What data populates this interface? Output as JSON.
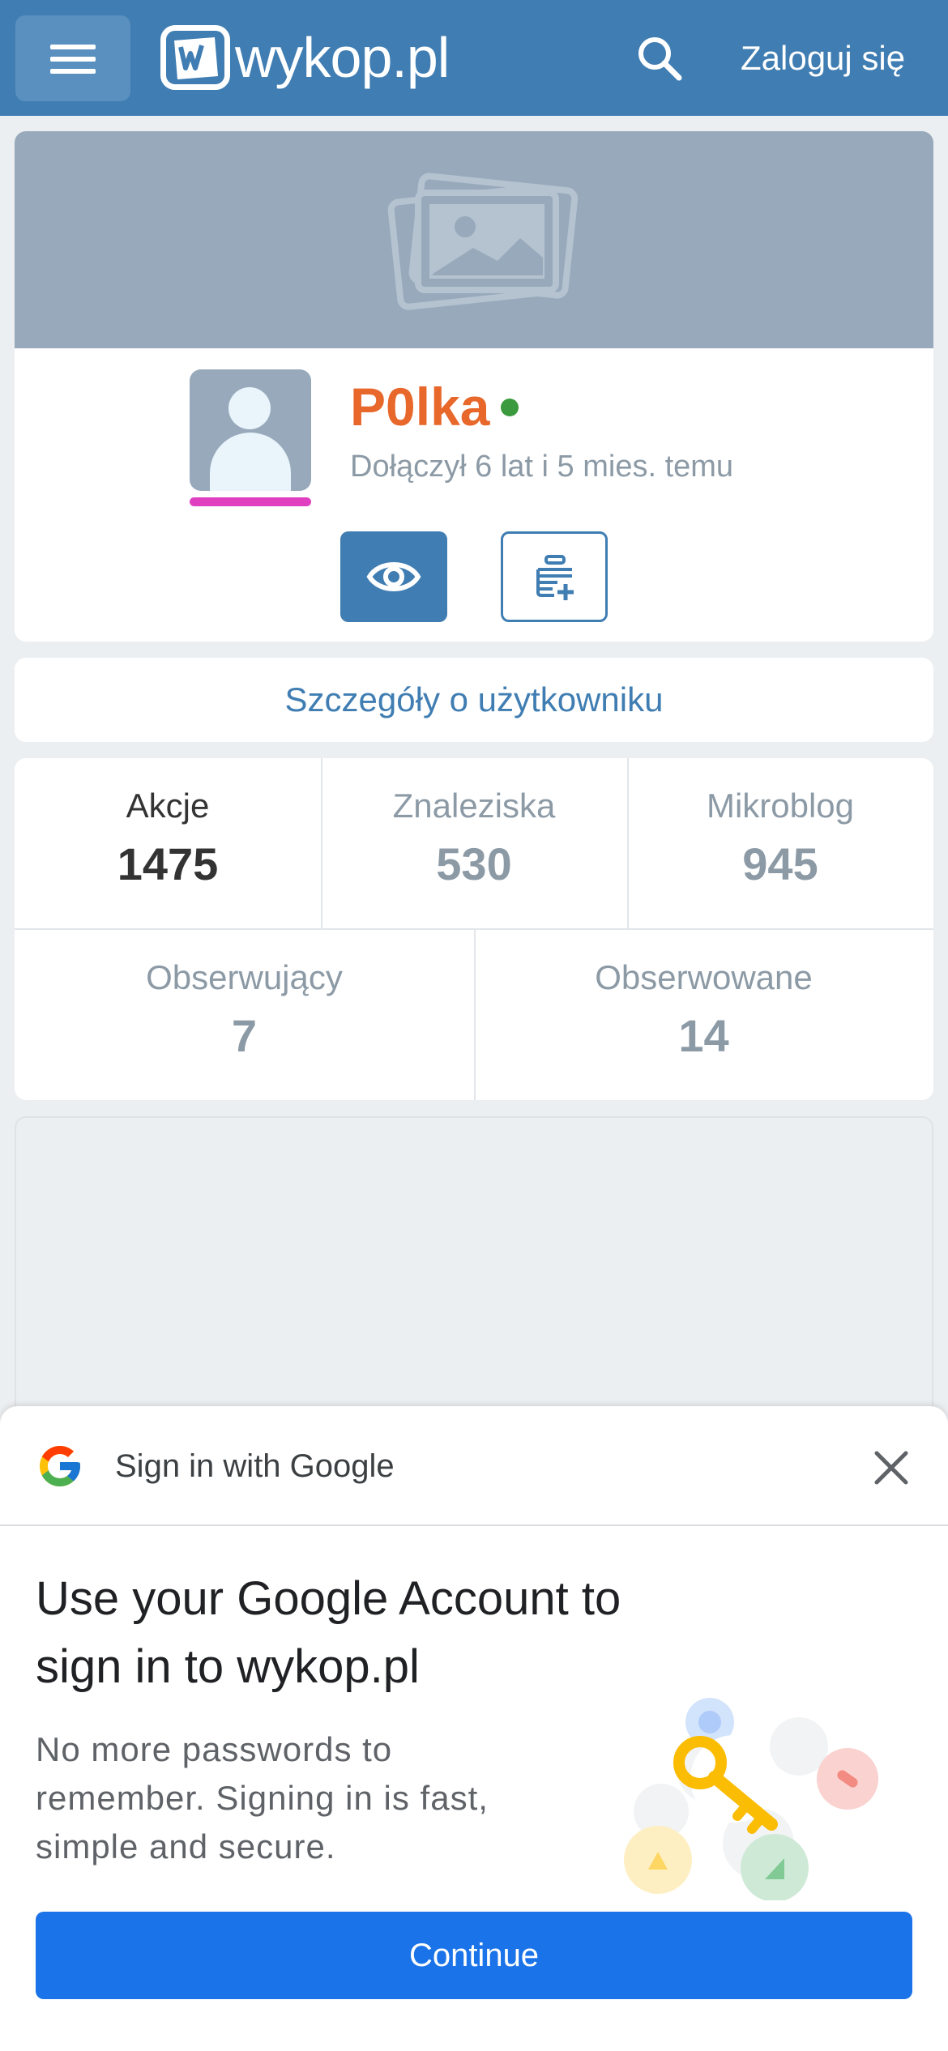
{
  "header": {
    "logo_text": "wykop.pl",
    "login_label": "Zaloguj się"
  },
  "profile": {
    "username": "P0lka",
    "joined": "Dołączył 6 lat i 5 mies. temu",
    "status": "online"
  },
  "details_label": "Szczegóły o użytkowniku",
  "stats": [
    {
      "label": "Akcje",
      "value": "1475"
    },
    {
      "label": "Znaleziska",
      "value": "530"
    },
    {
      "label": "Mikroblog",
      "value": "945"
    },
    {
      "label": "Obserwujący",
      "value": "7"
    },
    {
      "label": "Obserwowane",
      "value": "14"
    }
  ],
  "google_sheet": {
    "title": "Sign in with Google",
    "heading": "Use your Google Account to sign in to wykop.pl",
    "body": "No more passwords to remember. Signing in is fast, simple and secure.",
    "continue_label": "Continue"
  },
  "colors": {
    "brand": "#3f7db2",
    "username": "#e8672a",
    "online": "#3a9a3d",
    "avatar_bar": "#e040c0",
    "google_blue": "#1a73e8"
  }
}
